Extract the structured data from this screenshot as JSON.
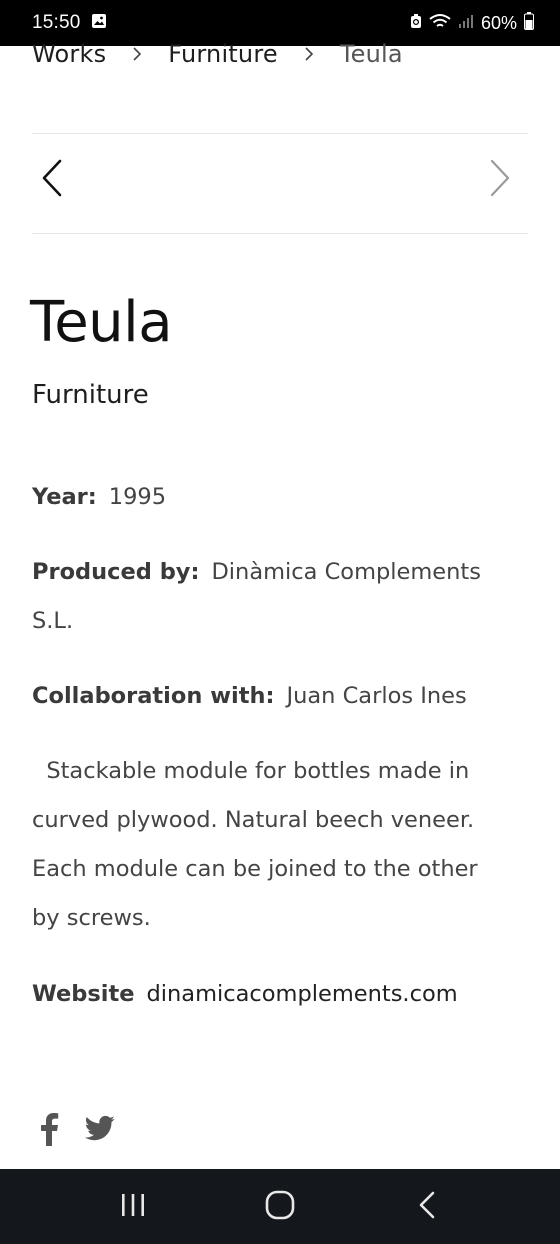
{
  "status_bar": {
    "time": "15:50",
    "battery": "60%"
  },
  "breadcrumb": {
    "items": [
      "Works",
      "Furniture",
      "Teula"
    ]
  },
  "work": {
    "title": "Teula",
    "category": "Furniture",
    "year_label": "Year:",
    "year": "1995",
    "produced_label": "Produced by:",
    "produced_by": "Dinàmica Complements S.L.",
    "collab_label": "Collaboration with:",
    "collaboration": "Juan Carlos Ines",
    "description": "  Stackable module for bottles made in curved plywood. Natural beech veneer. Each module can be joined to the other by screws.",
    "website_label": "Website",
    "website": "dinamicacomplements.com"
  },
  "icons": {
    "prev": "chevron-left-icon",
    "next": "chevron-right-icon",
    "social": [
      "facebook-icon",
      "twitter-icon"
    ]
  },
  "colors": {
    "text": "#3a3a3a",
    "title": "#111111",
    "status_bar": "#000000",
    "nav_bar": "#14171c"
  }
}
